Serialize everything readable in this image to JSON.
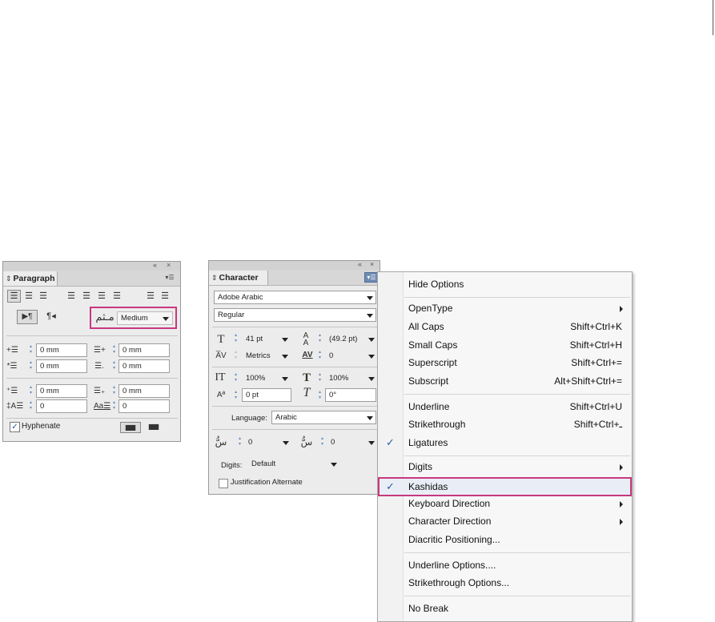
{
  "paragraph_panel": {
    "tab_title": "Paragraph",
    "collapse_glyph": "«",
    "close_glyph": "×",
    "kashida_value": "Medium",
    "left_indent": "0 mm",
    "right_indent": "0 mm",
    "first_line_indent": "0 mm",
    "last_line_indent": "0 mm",
    "space_before": "0 mm",
    "space_after": "0 mm",
    "dropcap_lines": "0",
    "dropcap_chars": "0",
    "hyphenate_label": "Hyphenate",
    "hyphenate_checked": true,
    "highlight_color": "#c8387f"
  },
  "character_panel": {
    "tab_title": "Character",
    "collapse_glyph": "«",
    "close_glyph": "×",
    "font_family": "Adobe Arabic",
    "font_style": "Regular",
    "font_size": "41 pt",
    "leading": "(49.2 pt)",
    "kerning": "Metrics",
    "tracking": "0",
    "vertical_scale": "100%",
    "horizontal_scale": "100%",
    "baseline_shift": "0 pt",
    "skew": "0°",
    "language_label": "Language:",
    "language_value": "Arabic",
    "diacritic_x": "0",
    "diacritic_y": "0",
    "digits_label": "Digits:",
    "digits_value": "Default",
    "justification_alternate_label": "Justification Alternate",
    "justification_alternate_checked": false
  },
  "flyout_menu": {
    "items": [
      {
        "label": "Hide Options",
        "shortcut": "",
        "submenu": false,
        "checked": false
      },
      {
        "label": "OpenType",
        "shortcut": "",
        "submenu": true,
        "checked": false
      },
      {
        "label": "All Caps",
        "shortcut": "Shift+Ctrl+K",
        "submenu": false,
        "checked": false
      },
      {
        "label": "Small Caps",
        "shortcut": "Shift+Ctrl+H",
        "submenu": false,
        "checked": false
      },
      {
        "label": "Superscript",
        "shortcut": "Shift+Ctrl+=",
        "submenu": false,
        "checked": false
      },
      {
        "label": "Subscript",
        "shortcut": "Alt+Shift+Ctrl+=",
        "submenu": false,
        "checked": false
      },
      {
        "label": "Underline",
        "shortcut": "Shift+Ctrl+U",
        "submenu": false,
        "checked": false
      },
      {
        "label": "Strikethrough",
        "shortcut": "Shift+Ctrl+ـ",
        "submenu": false,
        "checked": false
      },
      {
        "label": "Ligatures",
        "shortcut": "",
        "submenu": false,
        "checked": true
      },
      {
        "label": "Digits",
        "shortcut": "",
        "submenu": true,
        "checked": false
      },
      {
        "label": "Kashidas",
        "shortcut": "",
        "submenu": false,
        "checked": true
      },
      {
        "label": "Keyboard Direction",
        "shortcut": "",
        "submenu": true,
        "checked": false
      },
      {
        "label": "Character Direction",
        "shortcut": "",
        "submenu": true,
        "checked": false
      },
      {
        "label": "Diacritic Positioning...",
        "shortcut": "",
        "submenu": false,
        "checked": false
      },
      {
        "label": "Underline Options....",
        "shortcut": "",
        "submenu": false,
        "checked": false
      },
      {
        "label": "Strikethrough Options...",
        "shortcut": "",
        "submenu": false,
        "checked": false
      },
      {
        "label": "No Break",
        "shortcut": "",
        "submenu": false,
        "checked": false
      }
    ],
    "check_glyph": "✓"
  }
}
